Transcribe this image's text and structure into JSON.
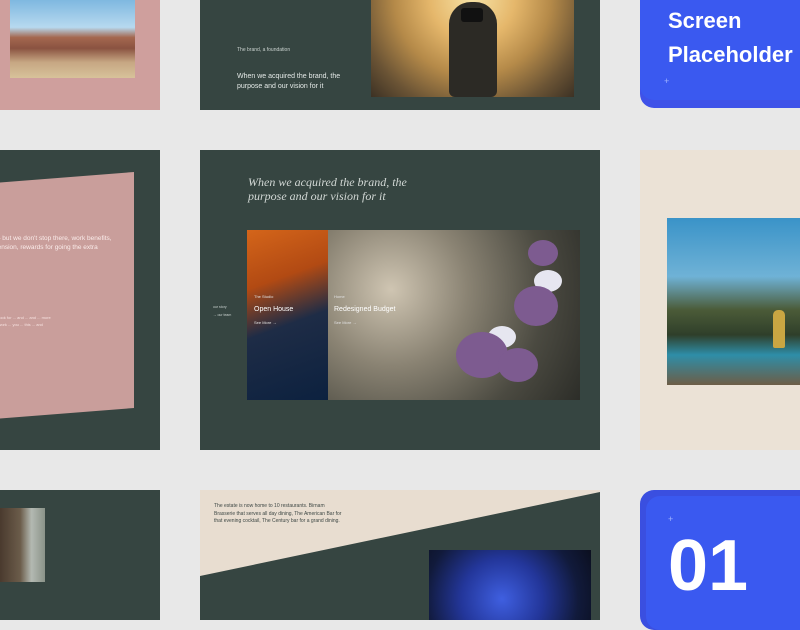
{
  "top_center": {
    "small_label": "The brand, a foundation",
    "body": "When we acquired the brand, the purpose and our vision for it"
  },
  "top_right": {
    "line1": "Screen",
    "line2": "Placeholder",
    "sparkle": "+"
  },
  "middle_left": {
    "text": "— but we don't stop there, work benefits, pension, rewards for going the extra",
    "small_text": "... look for ... and ... and ... more ... work ... you ... this ... and"
  },
  "middle_center": {
    "heading": "When we acquired the brand, the purpose and our vision for it",
    "side_label_1": "our story",
    "side_label_2": "→ our team",
    "tile1": {
      "eyebrow": "The Studio",
      "title": "Open House",
      "link": "See More →"
    },
    "tile2": {
      "eyebrow": "Home",
      "title": "Redesigned Budget",
      "link": "See More →"
    }
  },
  "bottom_center": {
    "text": "The estate is now home to 10 restaurants. Birnam Brasserie that serves all day dining, The American Bar for that evening cocktail, The Century bar for a grand dining."
  },
  "bottom_right": {
    "number": "01",
    "sparkle": "+"
  },
  "colors": {
    "page_bg": "#e8e8e8",
    "dark_green": "#364541",
    "pink": "#cf9f9d",
    "beige": "#ebe2d6",
    "blue": "#3a59f0"
  }
}
